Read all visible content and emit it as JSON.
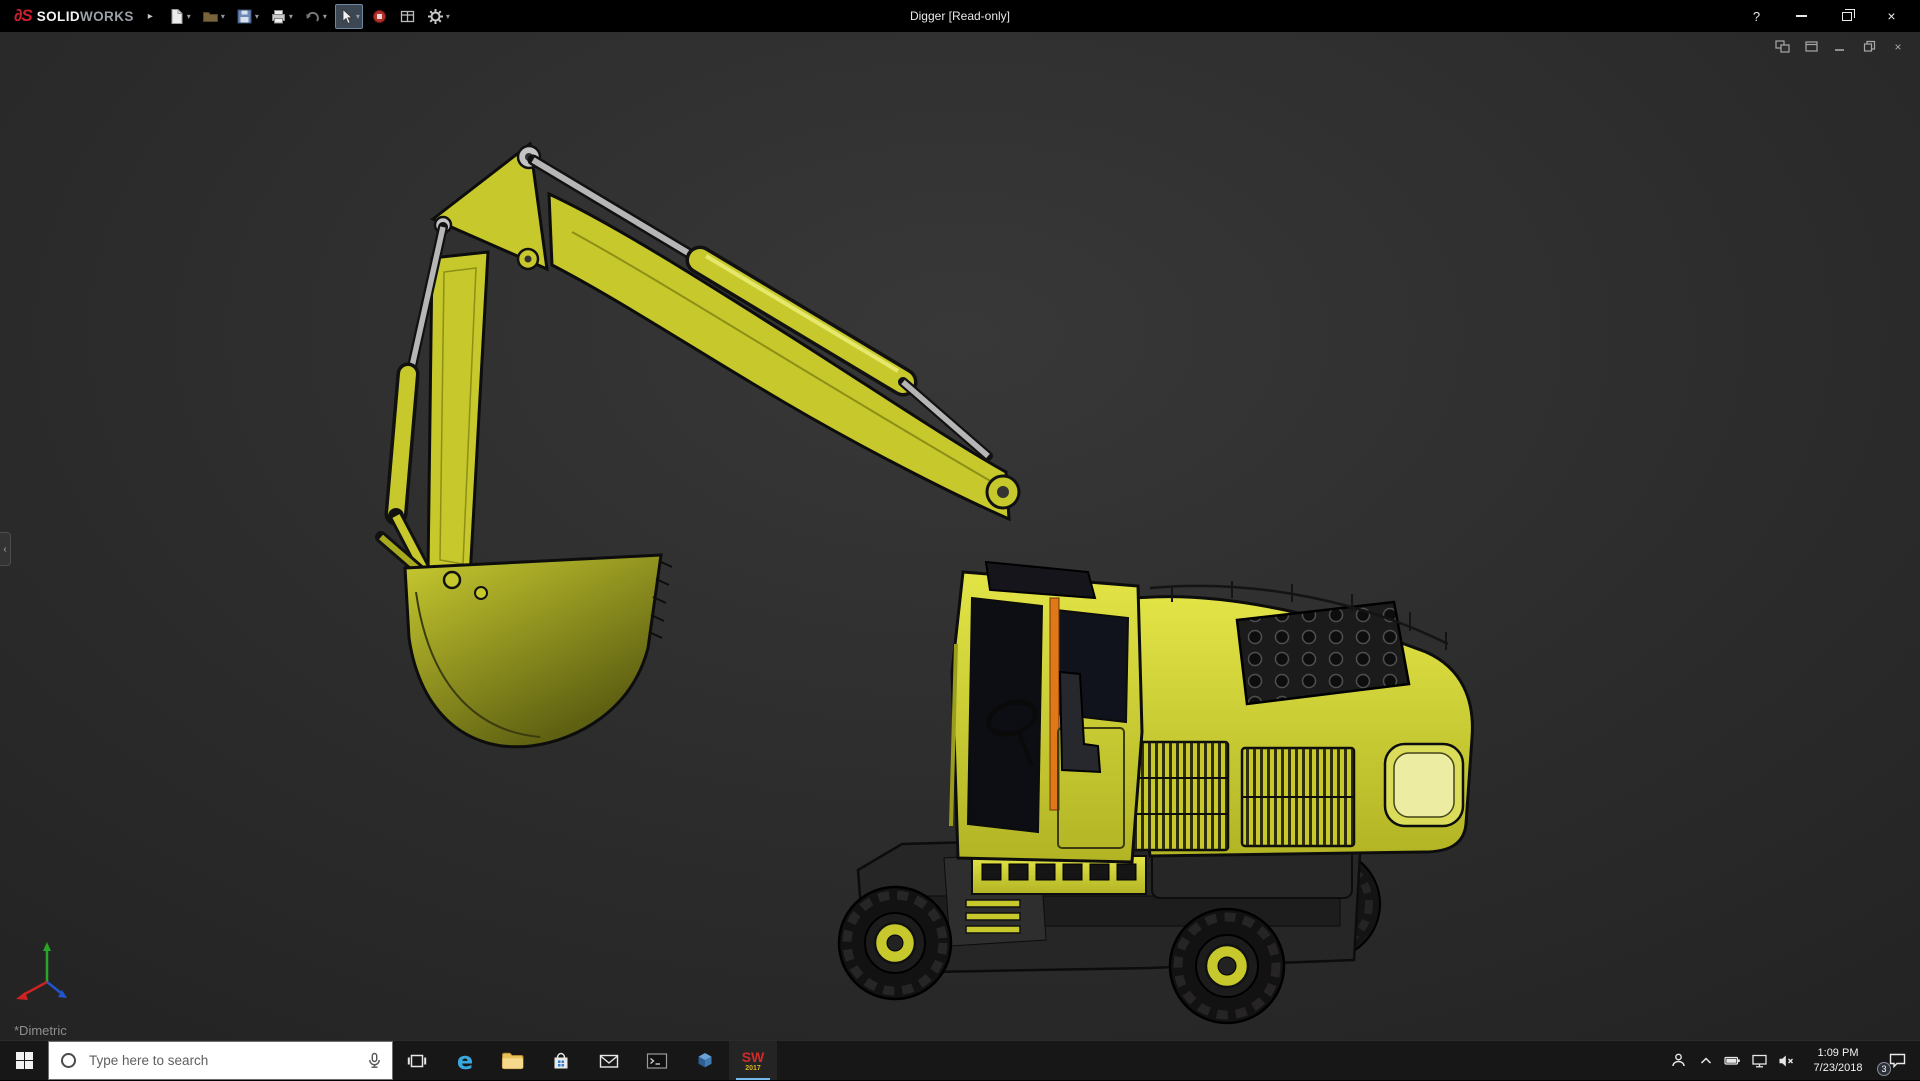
{
  "colors": {
    "titlebar-bg": "#000000",
    "taskbar-bg": "#171717",
    "excavator-yellow": "#c6c82c",
    "active-accent": "#76b9ed",
    "orange-accent": "#e07818",
    "icon-light": "#e8e8e8"
  },
  "glyphs": {
    "dropdown": "▾",
    "expand": "▸",
    "close": "×",
    "flyout": "‹",
    "help": "?"
  },
  "title_bar": {
    "logo_glyph": "∂S",
    "brand_solid": "SOLID",
    "brand_works": "WORKS",
    "document_title": "Digger [Read-only]",
    "toolbar_icons": [
      "new-document",
      "open-document",
      "save",
      "print",
      "undo",
      "select-tool",
      "apps",
      "evaluate",
      "options"
    ]
  },
  "viewport": {
    "view_orientation": "*Dimetric",
    "model_name": "Digger excavator assembly",
    "doc_window_controls": [
      "new-window",
      "cascade",
      "minimize",
      "restore",
      "close"
    ]
  },
  "taskbar": {
    "search": {
      "placeholder": "Type here to search"
    },
    "apps": [
      "start",
      "search",
      "task-view",
      "edge",
      "file-explorer",
      "store",
      "mail",
      "terminal",
      "edrawings",
      "solidworks-2017"
    ],
    "edge_glyph": "e",
    "sw_glyph": "SW",
    "sw_year": "2017",
    "tray": {
      "icons": [
        "people",
        "hidden-icons-chevron",
        "battery",
        "network",
        "volume-muted"
      ],
      "time": "1:09 PM",
      "date": "7/23/2018",
      "notification_count": "3"
    }
  }
}
